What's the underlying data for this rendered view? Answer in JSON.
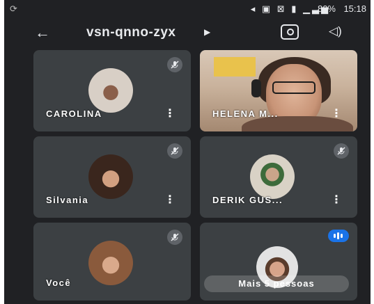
{
  "status_bar": {
    "left_icon": "⟳",
    "icons": "◂ ▣ ⊠ ▮ ▁▃▅",
    "battery": "80%",
    "time": "15:18"
  },
  "header": {
    "meeting_code": "vsn-qnno-zyx"
  },
  "participants": [
    {
      "name": "CAROLINA",
      "muted": true,
      "avatar_color": "#d8cfc6"
    },
    {
      "name": "HELENA M...",
      "muted": false,
      "video": true
    },
    {
      "name": "Silvania",
      "muted": true,
      "avatar_color": "#6d4a3a"
    },
    {
      "name": "DERIK GUS...",
      "muted": true,
      "avatar_color": "#a08670"
    },
    {
      "name": "Você",
      "muted": true,
      "avatar_color": "#c89a7a"
    }
  ],
  "more_tile": {
    "label": "Mais 5 pessoas"
  },
  "colors": {
    "background": "#202124",
    "tile": "#3c4043",
    "accent_blue": "#1a73e8"
  }
}
